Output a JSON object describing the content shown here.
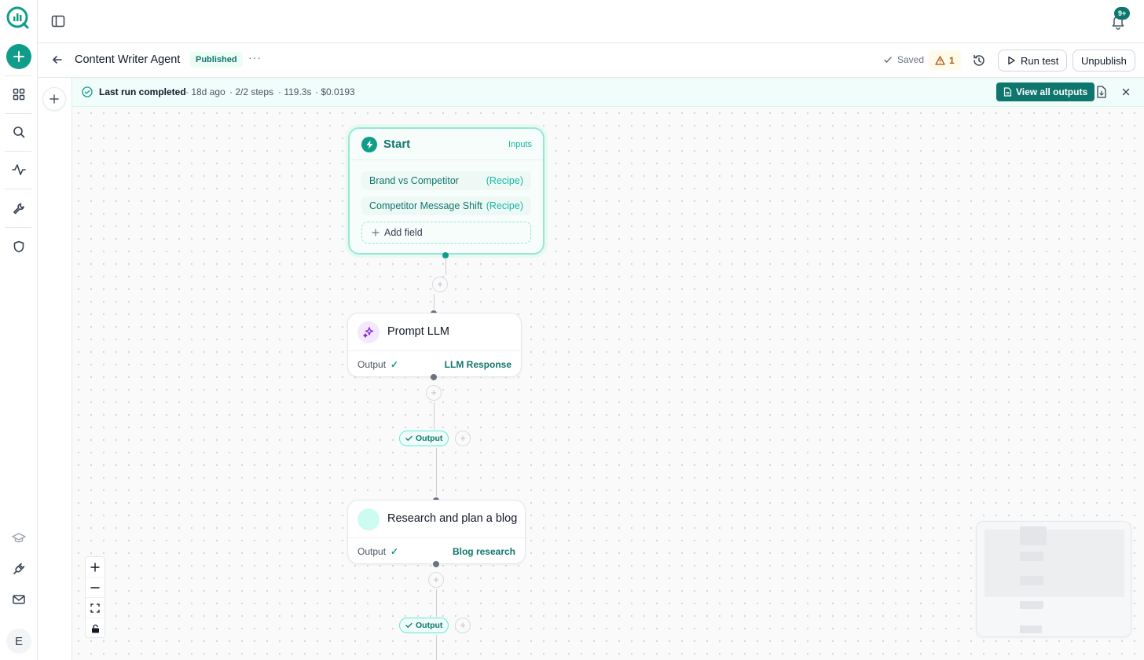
{
  "nav": {
    "avatar_letter": "E",
    "items": [
      "dashboard-icon",
      "search-icon",
      "activity-icon",
      "wrench-icon",
      "shield-icon",
      "graduation-cap-icon",
      "plug-icon",
      "mail-icon"
    ]
  },
  "header": {
    "notifications_badge": "9+"
  },
  "workflow": {
    "title": "Content Writer Agent",
    "status_badge": "Published",
    "more": "···",
    "saved_label": "Saved",
    "warning_count": "1",
    "run_test_label": "Run test",
    "unpublish_label": "Unpublish"
  },
  "last_run": {
    "status": "Last run completed",
    "time_ago": "· 18d ago",
    "steps": "· 2/2 steps",
    "duration": "· 119.3s",
    "cost": "· $0.0193",
    "view_all_label": "View all outputs"
  },
  "start_node": {
    "title": "Start",
    "inputs_label": "Inputs",
    "fields": [
      {
        "name": "Brand vs Competitor",
        "type": "(Recipe)"
      },
      {
        "name": "Competitor Message Shift",
        "type": "(Recipe)"
      }
    ],
    "add_field_label": "Add field"
  },
  "steps": [
    {
      "title": "Prompt LLM",
      "output_label": "Output",
      "output_check": "✓",
      "output_name": "LLM Response",
      "pill_label": "Output"
    },
    {
      "title": "Research and plan a blog",
      "output_label": "Output",
      "output_check": "✓",
      "output_name": "Blog research",
      "pill_label": "Output"
    }
  ],
  "colors": {
    "brand": "#0f9d8a",
    "brand_dark": "#0f766e",
    "warning": "#b45309"
  }
}
